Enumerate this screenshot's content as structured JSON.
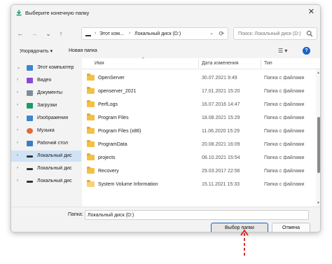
{
  "window": {
    "title": "Выберите конечную папку",
    "close_glyph": "✕"
  },
  "nav": {
    "back": "←",
    "forward": "→",
    "dropdown": "⌄",
    "up": "↑",
    "address_segments": [
      "Этот ком...",
      "Локальный диск (D:)"
    ],
    "address_chevron": "›",
    "search_placeholder": "Поиск: Локальный диск (D:)"
  },
  "toolbar": {
    "organize_label": "Упорядочить ▾",
    "new_folder_label": "Новая папка",
    "view_glyph": "☰ ▾",
    "help_glyph": "?"
  },
  "sidebar": {
    "items": [
      {
        "label": "Этот компьютер",
        "chevron": "⌄",
        "icon": "computer-icon",
        "color": "#3a86d1"
      },
      {
        "label": "Видео",
        "chevron": "›",
        "icon": "video-icon",
        "color": "#8a4bd0"
      },
      {
        "label": "Документы",
        "chevron": "›",
        "icon": "documents-icon",
        "color": "#7f8c99"
      },
      {
        "label": "Загрузки",
        "chevron": "›",
        "icon": "downloads-icon",
        "color": "#1f9a67"
      },
      {
        "label": "Изображения",
        "chevron": "›",
        "icon": "pictures-icon",
        "color": "#3b86cc"
      },
      {
        "label": "Музыка",
        "chevron": "›",
        "icon": "music-icon",
        "color": "#e06b3c"
      },
      {
        "label": "Рабочий стол",
        "chevron": "›",
        "icon": "desktop-icon",
        "color": "#3b7fc4"
      },
      {
        "label": "Локальный дис",
        "chevron": "›",
        "icon": "drive-icon",
        "color": "#333333"
      },
      {
        "label": "Локальный дис",
        "chevron": "›",
        "icon": "drive-icon",
        "color": "#333333"
      },
      {
        "label": "Локальный дис",
        "chevron": "›",
        "icon": "drive-icon",
        "color": "#333333"
      }
    ]
  },
  "columns": {
    "name": "Имя",
    "date": "Дата изменения",
    "type": "Тип",
    "sort_glyph": "^"
  },
  "files": [
    {
      "name": "OpenServer",
      "date": "30.07.2021 9:49",
      "type": "Папка с файлами"
    },
    {
      "name": "openserver_2021",
      "date": "17.01.2021 15:20",
      "type": "Папка с файлами"
    },
    {
      "name": "PerfLogs",
      "date": "16.07.2016 14:47",
      "type": "Папка с файлами"
    },
    {
      "name": "Program Files",
      "date": "18.08.2021 15:29",
      "type": "Папка с файлами"
    },
    {
      "name": "Program Files (x86)",
      "date": "11.06.2020 15:29",
      "type": "Папка с файлами"
    },
    {
      "name": "ProgramData",
      "date": "20.08.2021 16:09",
      "type": "Папка с файлами"
    },
    {
      "name": "projects",
      "date": "08.10.2021 15:54",
      "type": "Папка с файлами"
    },
    {
      "name": "Recovery",
      "date": "29.03.2017 22:56",
      "type": "Папка с файлами"
    },
    {
      "name": "System Volume Information",
      "date": "15.11.2021 15:33",
      "type": "Папка с файлами"
    }
  ],
  "footer": {
    "folder_label": "Папка:",
    "folder_value": "Локальный диск (D:)",
    "select_button": "Выбор папки",
    "cancel_button": "Отмена"
  },
  "colors": {
    "accent": "#1a62c7",
    "selection": "#cfe3f5",
    "folder": "#f2c146",
    "annotation": "#d9322b"
  }
}
